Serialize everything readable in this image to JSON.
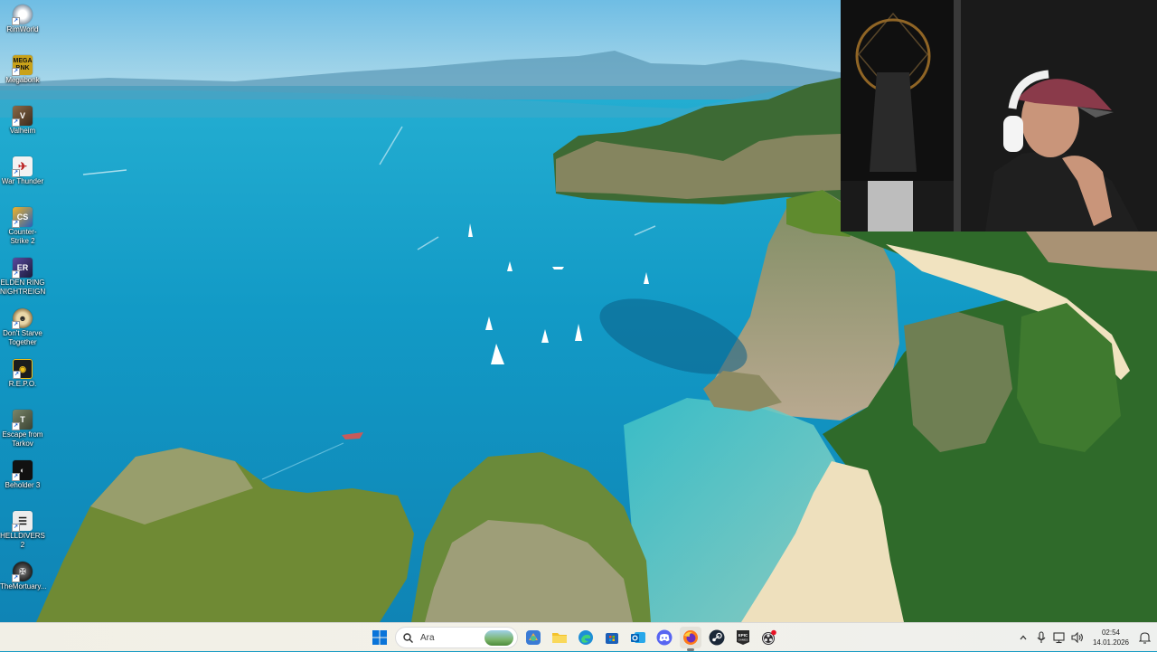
{
  "desktop": {
    "icons": [
      {
        "label": "RimWorld",
        "icon": "rimworld-icon",
        "color": "#dcdcdc"
      },
      {
        "label": "Megabonk",
        "icon": "megabonk-icon",
        "color": "#c9a21a"
      },
      {
        "label": "Valheim",
        "icon": "valheim-icon",
        "color": "#6a4a32"
      },
      {
        "label": "War Thunder",
        "icon": "war-thunder-icon",
        "color": "#e8e8e8"
      },
      {
        "label": "Counter-Strike 2",
        "icon": "counter-strike-2-icon",
        "color": "#e2a21e"
      },
      {
        "label": "ELDEN RING NIGHTREIGN",
        "icon": "elden-ring-nightreign-icon",
        "color": "#3c3a6e"
      },
      {
        "label": "Don't Starve Together",
        "icon": "dont-starve-together-icon",
        "color": "#b58b48"
      },
      {
        "label": "R.E.P.O.",
        "icon": "repo-icon",
        "color": "#222222"
      },
      {
        "label": "Escape from Tarkov",
        "icon": "escape-from-tarkov-icon",
        "color": "#5f6a52"
      },
      {
        "label": "Beholder 3",
        "icon": "beholder-3-icon",
        "color": "#1c1c1c"
      },
      {
        "label": "HELLDIVERS 2",
        "icon": "helldivers-2-icon",
        "color": "#2a2a2a"
      },
      {
        "label": "TheMortuary...",
        "icon": "the-mortuary-icon",
        "color": "#3a3a3a"
      }
    ]
  },
  "taskbar": {
    "search_placeholder": "Ara",
    "apps": [
      {
        "name": "start-button",
        "icon": "windows-logo-icon"
      },
      {
        "name": "copilot-app",
        "icon": "copilot-icon"
      },
      {
        "name": "file-explorer-app",
        "icon": "folder-icon"
      },
      {
        "name": "edge-app",
        "icon": "edge-icon"
      },
      {
        "name": "store-app",
        "icon": "store-icon"
      },
      {
        "name": "outlook-app",
        "icon": "outlook-icon"
      },
      {
        "name": "discord-app",
        "icon": "discord-icon"
      },
      {
        "name": "firefox-app",
        "icon": "firefox-icon"
      },
      {
        "name": "steam-app",
        "icon": "steam-icon"
      },
      {
        "name": "epic-games-app",
        "icon": "epic-games-icon"
      },
      {
        "name": "obs-app",
        "icon": "obs-icon"
      }
    ],
    "tray": {
      "time": "02:54",
      "date": "14.01.2026"
    }
  },
  "colors": {
    "accent": "#0a64c8",
    "sea": "#1aa3cc",
    "taskbar": "#f1efe6"
  }
}
